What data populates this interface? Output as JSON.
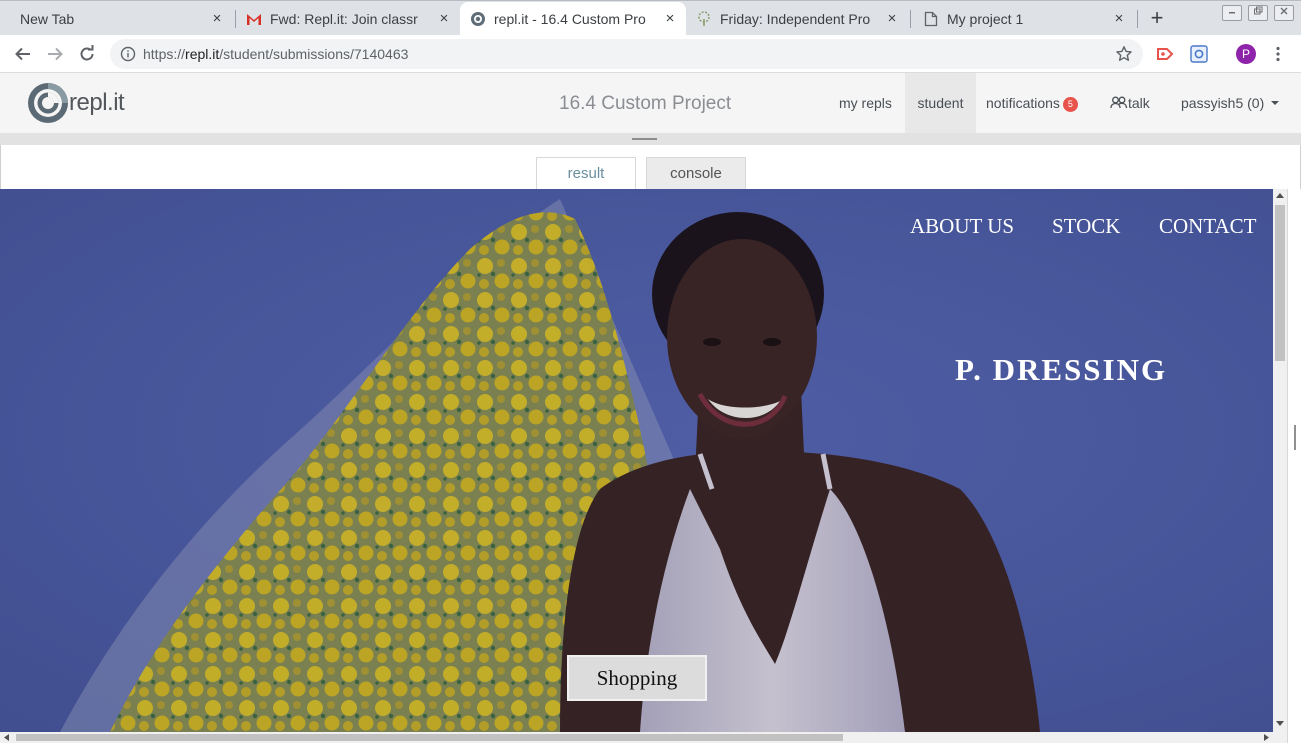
{
  "browser": {
    "tabs": [
      {
        "title": "New Tab",
        "icon": "none",
        "active": false
      },
      {
        "title": "Fwd: Repl.it: Join classr",
        "icon": "gmail-icon",
        "active": false
      },
      {
        "title": "repl.it - 16.4 Custom Pro",
        "icon": "replit-icon",
        "active": true
      },
      {
        "title": "Friday: Independent Pro",
        "icon": "tree-icon",
        "active": false
      },
      {
        "title": "My project 1",
        "icon": "document-icon",
        "active": false
      }
    ],
    "new_tab_label": "+",
    "close_glyph": "×",
    "url_prefix": "https://",
    "url_host": "repl.it",
    "url_path": "/student/submissions/7140463",
    "profile_initial": "P"
  },
  "replit": {
    "logo_text": "repl.it",
    "page_title": "16.4 Custom Project",
    "nav": {
      "my_repls": "my repls",
      "student": "student",
      "notifications": "notifications",
      "notification_count": "5",
      "talk": "talk",
      "user": "passyish5 (0)"
    },
    "tabs": {
      "result": "result",
      "console": "console"
    }
  },
  "site": {
    "nav": [
      "ABOUT US",
      "STOCK",
      "CONTACT"
    ],
    "brand": "P. DRESSING",
    "cta": "Shopping"
  },
  "colors": {
    "hero_background": "#4e5ea7",
    "notification_badge": "#e8544b",
    "profile_avatar": "#8e24aa",
    "result_tab_text": "#6a8ea0"
  }
}
